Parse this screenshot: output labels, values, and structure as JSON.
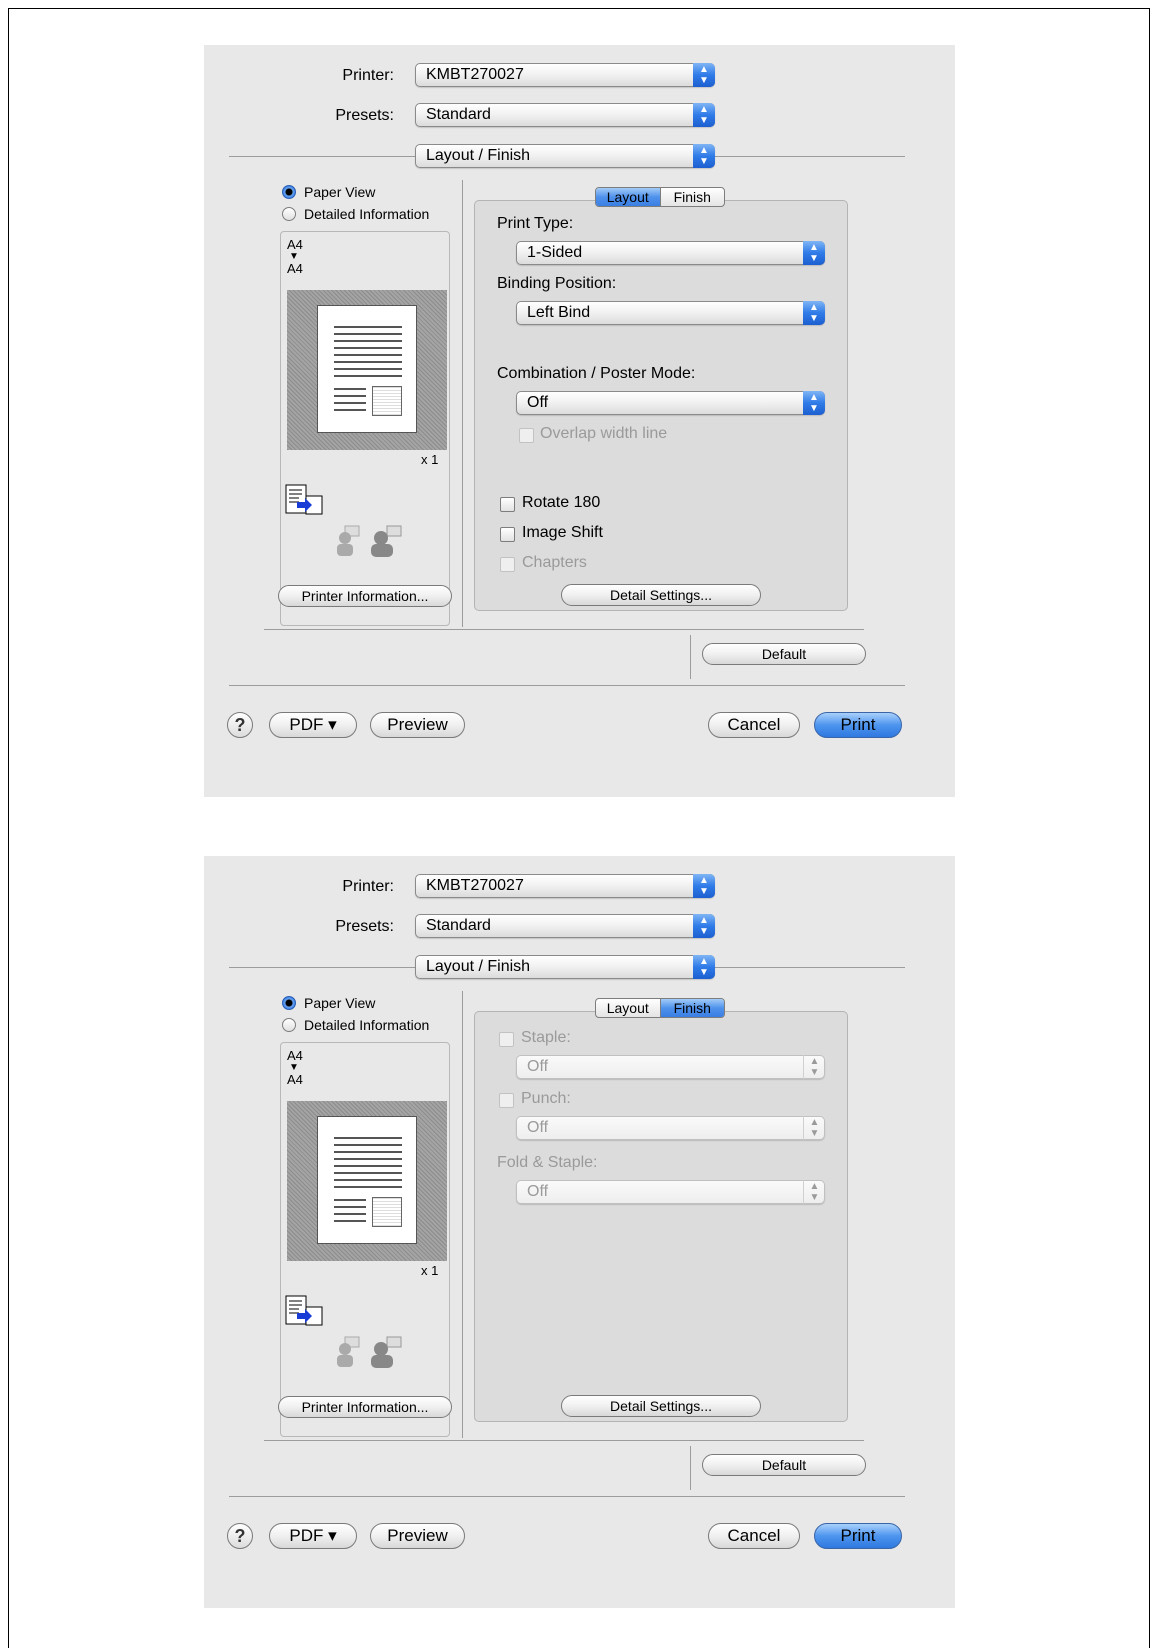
{
  "dialogs": [
    {
      "printer": {
        "label": "Printer:",
        "value": "KMBT270027"
      },
      "presets": {
        "label": "Presets:",
        "value": "Standard"
      },
      "pane": {
        "value": "Layout / Finish"
      },
      "view": {
        "paper_view": "Paper View",
        "detailed_info": "Detailed Information",
        "selected": "Paper View"
      },
      "paper": {
        "from": "A4",
        "arrow": "▼",
        "to": "A4",
        "copies": "x 1"
      },
      "printer_info_button": "Printer Information...",
      "tabs": [
        {
          "label": "Layout",
          "selected": true
        },
        {
          "label": "Finish",
          "selected": false
        }
      ],
      "layout": {
        "print_type": {
          "label": "Print Type:",
          "value": "1-Sided"
        },
        "binding_position": {
          "label": "Binding Position:",
          "value": "Left Bind"
        },
        "combination": {
          "label": "Combination / Poster Mode:",
          "value": "Off"
        },
        "overlap_width_line": {
          "label": "Overlap width line",
          "checked": false,
          "enabled": false
        },
        "rotate_180": {
          "label": "Rotate 180",
          "checked": false,
          "enabled": true
        },
        "image_shift": {
          "label": "Image Shift",
          "checked": false,
          "enabled": true
        },
        "chapters": {
          "label": "Chapters",
          "checked": false,
          "enabled": false
        }
      },
      "detail_settings_button": "Detail Settings...",
      "default_button": "Default",
      "bottom": {
        "help": "?",
        "pdf": "PDF ▾",
        "preview": "Preview",
        "cancel": "Cancel",
        "print": "Print"
      }
    },
    {
      "printer": {
        "label": "Printer:",
        "value": "KMBT270027"
      },
      "presets": {
        "label": "Presets:",
        "value": "Standard"
      },
      "pane": {
        "value": "Layout / Finish"
      },
      "view": {
        "paper_view": "Paper View",
        "detailed_info": "Detailed Information",
        "selected": "Paper View"
      },
      "paper": {
        "from": "A4",
        "arrow": "▼",
        "to": "A4",
        "copies": "x 1"
      },
      "printer_info_button": "Printer Information...",
      "tabs": [
        {
          "label": "Layout",
          "selected": false
        },
        {
          "label": "Finish",
          "selected": true
        }
      ],
      "finish": {
        "staple": {
          "label": "Staple:",
          "checked": false,
          "enabled": false,
          "value": "Off"
        },
        "punch": {
          "label": "Punch:",
          "checked": false,
          "enabled": false,
          "value": "Off"
        },
        "fold_staple": {
          "label": "Fold & Staple:",
          "enabled": false,
          "value": "Off"
        }
      },
      "detail_settings_button": "Detail Settings...",
      "default_button": "Default",
      "bottom": {
        "help": "?",
        "pdf": "PDF ▾",
        "preview": "Preview",
        "cancel": "Cancel",
        "print": "Print"
      }
    }
  ]
}
